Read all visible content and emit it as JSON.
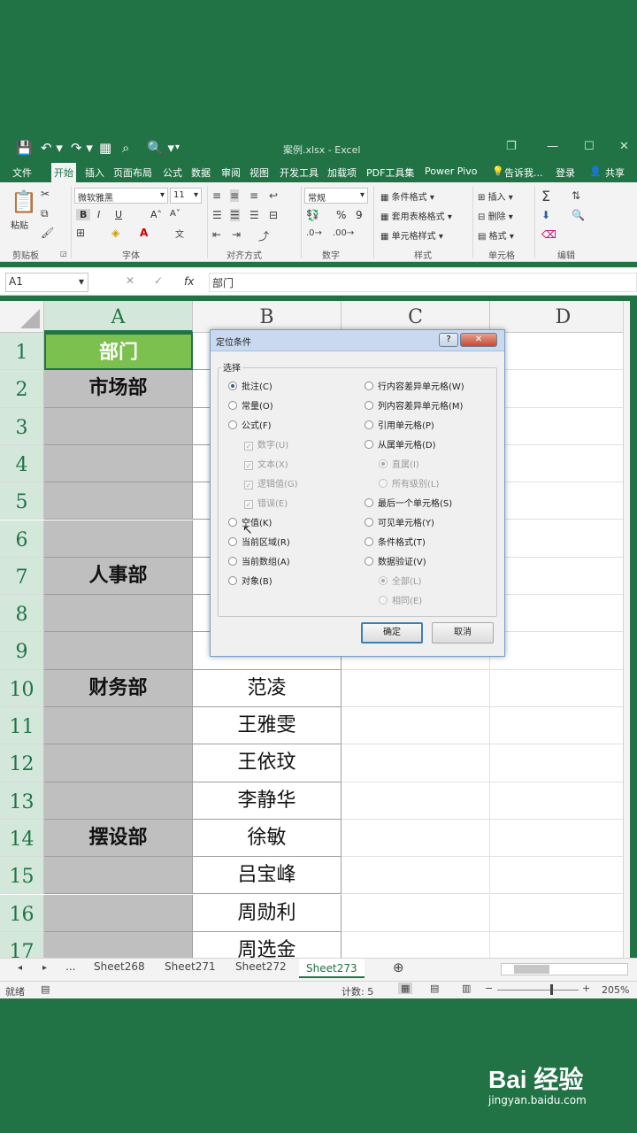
{
  "window": {
    "title": "案例.xlsx - Excel",
    "controls": [
      "❐",
      "—",
      "☐",
      "✕"
    ]
  },
  "qat": [
    "💾",
    "↶ ▾",
    "↷ ▾",
    "▦",
    "⌕",
    "🔍 ▾",
    "▾"
  ],
  "tabs": [
    "文件",
    "开始",
    "插入",
    "页面布局",
    "公式",
    "数据",
    "审阅",
    "视图",
    "开发工具",
    "加载项",
    "PDF工具集",
    "Power Pivo",
    "告诉我...",
    "登录",
    "共享"
  ],
  "ribbon": {
    "paste": "粘贴",
    "font_name": "微软雅黑",
    "font_size": "11",
    "bold": "B",
    "italic": "I",
    "underline": "U",
    "grow_font": "A˄",
    "shrink_font": "A˅",
    "number_format": "常规",
    "percent": "%",
    "comma": "9",
    "cond_format": "条件格式",
    "table_format": "套用表格格式",
    "cell_style": "单元格样式",
    "insert": "插入",
    "delete": "删除",
    "format": "格式",
    "groups": [
      "剪贴板",
      "字体",
      "对齐方式",
      "数字",
      "样式",
      "单元格",
      "编辑"
    ]
  },
  "formula_bar": {
    "name_box": "A1",
    "fx": "fx",
    "content": "部门"
  },
  "grid": {
    "columns": [
      "A",
      "B",
      "C",
      "D"
    ],
    "rows": [
      "1",
      "2",
      "3",
      "4",
      "5",
      "6",
      "7",
      "8",
      "9",
      "10",
      "11",
      "12",
      "13",
      "14",
      "15",
      "16",
      "17"
    ],
    "colA": [
      "部门",
      "市场部",
      "",
      "",
      "",
      "",
      "人事部",
      "",
      "",
      "财务部",
      "",
      "",
      "",
      "摆设部",
      "",
      "",
      ""
    ],
    "colB": [
      "",
      "",
      "",
      "",
      "",
      "",
      "",
      "",
      "",
      "范凌",
      "王雅雯",
      "王依玟",
      "李静华",
      "徐敏",
      "吕宝峰",
      "周勋利",
      "周选金"
    ]
  },
  "dialog": {
    "title": "定位条件",
    "help": "?",
    "close": "✕",
    "group_label": "选择",
    "left_options": [
      {
        "label": "批注(C)",
        "checked": true
      },
      {
        "label": "常量(O)",
        "checked": false
      },
      {
        "label": "公式(F)",
        "checked": false
      },
      {
        "label": "数字(U)",
        "checked": true
      },
      {
        "label": "文本(X)",
        "checked": true
      },
      {
        "label": "逻辑值(G)",
        "checked": true
      },
      {
        "label": "错误(E)",
        "checked": true
      },
      {
        "label": "空值(K)",
        "checked": false
      },
      {
        "label": "当前区域(R)",
        "checked": false
      },
      {
        "label": "当前数组(A)",
        "checked": false
      },
      {
        "label": "对象(B)",
        "checked": false
      }
    ],
    "right_options": [
      {
        "label": "行内容差异单元格(W)",
        "checked": false
      },
      {
        "label": "列内容差异单元格(M)",
        "checked": false
      },
      {
        "label": "引用单元格(P)",
        "checked": false
      },
      {
        "label": "从属单元格(D)",
        "checked": false
      },
      {
        "label": "直属(I)",
        "checked": true
      },
      {
        "label": "所有级别(L)",
        "checked": false
      },
      {
        "label": "最后一个单元格(S)",
        "checked": false
      },
      {
        "label": "可见单元格(Y)",
        "checked": false
      },
      {
        "label": "条件格式(T)",
        "checked": false
      },
      {
        "label": "数据验证(V)",
        "checked": false
      },
      {
        "label": "全部(L)",
        "checked": true
      },
      {
        "label": "相同(E)",
        "checked": false
      }
    ],
    "ok": "确定",
    "cancel": "取消"
  },
  "sheets": {
    "nav": [
      "◂",
      "▸",
      "..."
    ],
    "tabs": [
      "Sheet268",
      "Sheet271",
      "Sheet272",
      "Sheet273"
    ],
    "active": "Sheet273",
    "add": "⊕"
  },
  "status": {
    "ready": "就绪",
    "count": "计数: 5",
    "zoom": "205%"
  },
  "watermark": {
    "brand": "Bai 经验",
    "url": "jingyan.baidu.com"
  },
  "colors": {
    "excel_green": "#217346",
    "header_green": "#7cc050",
    "selection": "#d3e7da"
  }
}
